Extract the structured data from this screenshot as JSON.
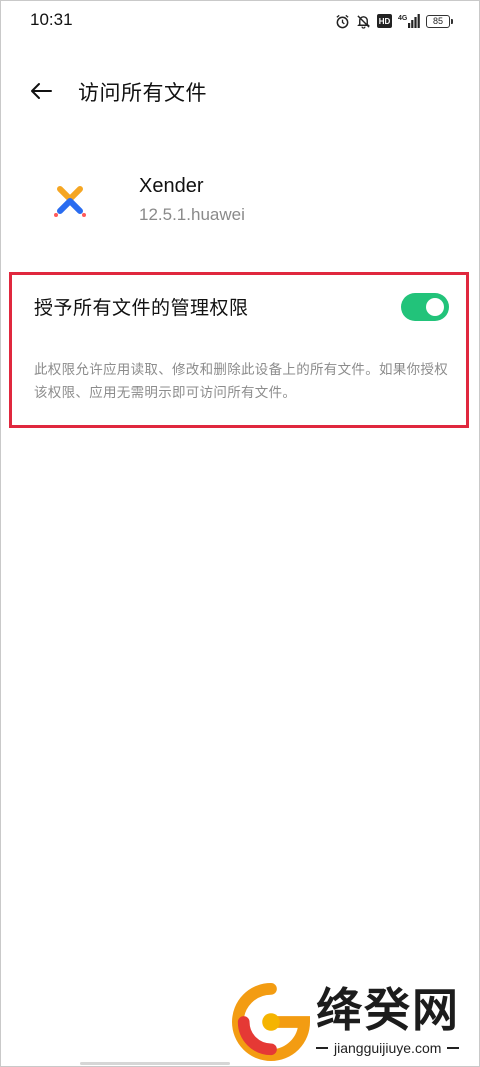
{
  "status_bar": {
    "time": "10:31",
    "icons": [
      "alarm-icon",
      "mute-icon",
      "hd-icon",
      "signal-4g-icon",
      "battery-icon"
    ],
    "hd_label": "HD",
    "network_label": "4G",
    "battery_level": "85"
  },
  "header": {
    "title": "访问所有文件",
    "back_icon": "arrow-left-icon"
  },
  "app": {
    "name": "Xender",
    "version": "12.5.1.huawei"
  },
  "permission": {
    "title": "授予所有文件的管理权限",
    "toggle_on": true,
    "description": "此权限允许应用读取、修改和删除此设备上的所有文件。如果你授权该权限、应用无需明示即可访问所有文件。"
  },
  "watermark": {
    "brand": "绛癸网",
    "url": "jiangguijiuye.com"
  },
  "colors": {
    "toggle_on": "#22c37a",
    "highlight_border": "#e0283e"
  }
}
